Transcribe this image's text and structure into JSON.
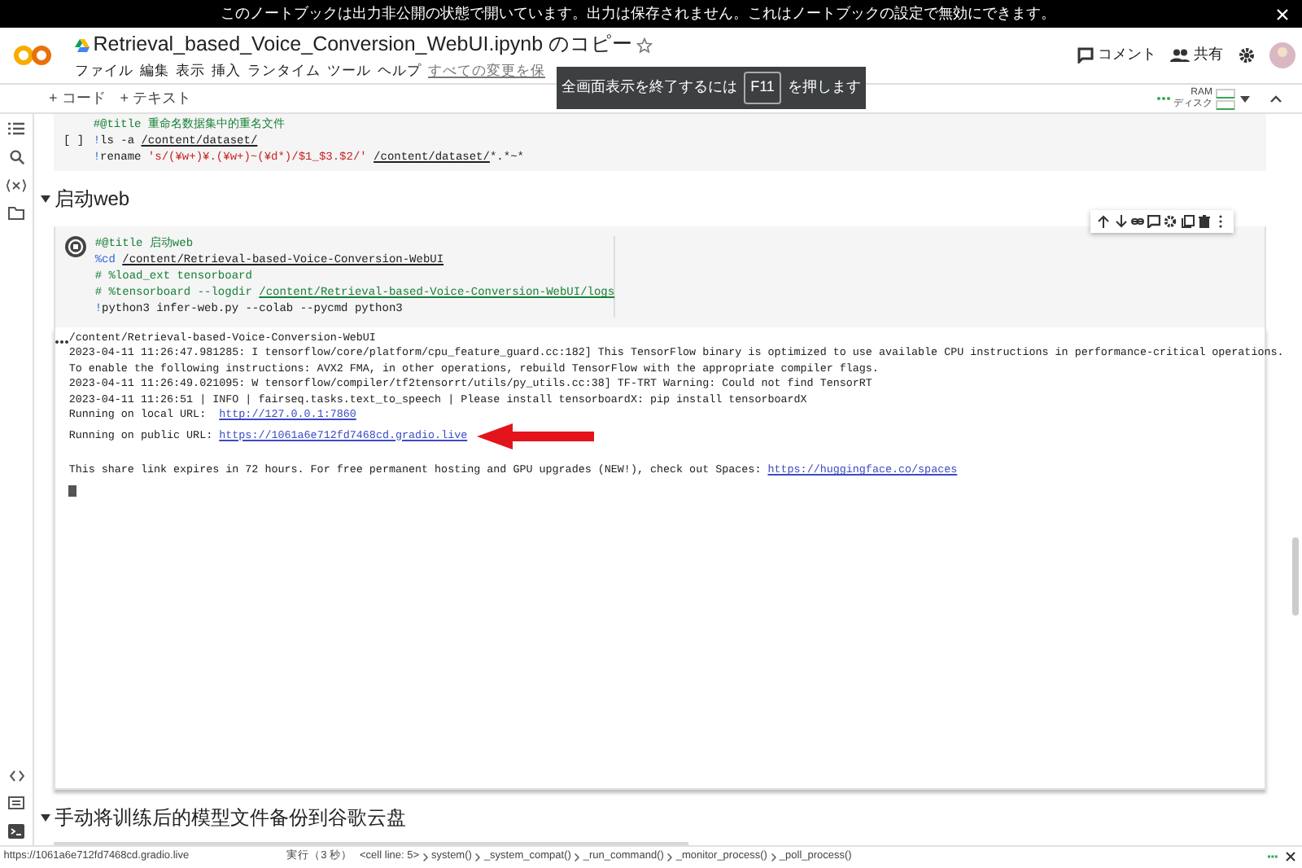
{
  "banner": {
    "text_before": "このノートブックは出力非公開の状態で開いています。出力は保存されません。これは",
    "link": "ノートブックの設定",
    "text_after": "で無効にできます。"
  },
  "header": {
    "title": "Retrieval_based_Voice_Conversion_WebUI.ipynb のコピー",
    "menu": [
      "ファイル",
      "編集",
      "表示",
      "挿入",
      "ランタイム",
      "ツール",
      "ヘルプ"
    ],
    "save_status": "すべての変更を保",
    "comment_button": "コメント",
    "share_button": "共有"
  },
  "toast": {
    "text_before": "全画面表示を終了するには",
    "key": "F11",
    "text_after": "を押します"
  },
  "toolbar": {
    "add_code": "+ コード",
    "add_text": "+ テキスト",
    "ram_label": "RAM",
    "disk_label": "ディスク"
  },
  "cells": [
    {
      "kind": "code",
      "partial": true,
      "run_label": "[ ]",
      "lines": [
        [
          {
            "kind": "comment",
            "text": "#@title 重命名数据集中的重名文件"
          }
        ],
        [
          {
            "kind": "magic",
            "text": "!"
          },
          {
            "kind": "plain",
            "text": "ls -a "
          },
          {
            "kind": "path",
            "text": "/content/dataset/"
          }
        ],
        [
          {
            "kind": "magic",
            "text": "!"
          },
          {
            "kind": "plain",
            "text": "rename "
          },
          {
            "kind": "string",
            "text": "'s/(¥w+)¥.(¥w+)~(¥d*)/$1_$3.$2/' "
          },
          {
            "kind": "path",
            "text": "/content/dataset/"
          },
          {
            "kind": "plain",
            "text": "*.*~*"
          }
        ]
      ]
    },
    {
      "kind": "section",
      "title": "启动web",
      "expanded": true
    },
    {
      "kind": "code",
      "partial": false,
      "running": true,
      "lines": [
        [
          {
            "kind": "comment",
            "text": "#@title 启动web"
          }
        ],
        [
          {
            "kind": "magic",
            "text": "%cd "
          },
          {
            "kind": "path",
            "text": "/content/Retrieval-based-Voice-Conversion-WebUI"
          }
        ],
        [
          {
            "kind": "comment",
            "text": "# %load_ext tensorboard"
          }
        ],
        [
          {
            "kind": "comment",
            "text": "# %tensorboard --logdir "
          },
          {
            "kind": "commentpath",
            "text": "/content/Retrieval-based-Voice-Conversion-WebUI/logs"
          }
        ],
        [
          {
            "kind": "magic",
            "text": "!"
          },
          {
            "kind": "plain",
            "text": "python3 infer-web.py --colab --pycmd python3"
          }
        ]
      ],
      "output": [
        [
          {
            "kind": "plain",
            "text": "/content/Retrieval-based-Voice-Conversion-WebUI"
          }
        ],
        [
          {
            "kind": "plain",
            "text": "2023-04-11 11:26:47.981285: I tensorflow/core/platform/cpu_feature_guard.cc:182] This TensorFlow binary is optimized to use available CPU instructions in performance-critical operations."
          }
        ],
        [
          {
            "kind": "plain",
            "text": "To enable the following instructions: AVX2 FMA, in other operations, rebuild TensorFlow with the appropriate compiler flags."
          }
        ],
        [
          {
            "kind": "plain",
            "text": "2023-04-11 11:26:49.021095: W tensorflow/compiler/tf2tensorrt/utils/py_utils.cc:38] TF-TRT Warning: Could not find TensorRT"
          }
        ],
        [
          {
            "kind": "plain",
            "text": "2023-04-11 11:26:51 | INFO | fairseq.tasks.text_to_speech | Please install tensorboardX: pip install tensorboardX"
          }
        ],
        [
          {
            "kind": "plain",
            "text": "Running on local URL:  "
          },
          {
            "kind": "link",
            "text": "http://127.0.0.1:7860"
          }
        ],
        [
          {
            "kind": "plain",
            "text": "Running on public URL: "
          },
          {
            "kind": "link",
            "text": "https://1061a6e712fd7468cd.gradio.live"
          }
        ],
        [
          {
            "kind": "gap"
          },
          {
            "kind": "plain",
            "text": "This share link expires in 72 hours. For free permanent hosting and GPU upgrades (NEW!), check out Spaces: "
          },
          {
            "kind": "link",
            "text": "https://huggingface.co/spaces"
          }
        ]
      ]
    },
    {
      "kind": "section",
      "title": "手动将训练后的模型文件备份到谷歌云盘",
      "expanded": true
    }
  ],
  "status_bar": {
    "link_preview": "https://1061a6e712fd7468cd.gradio.live",
    "run_time": "実行（3 秒）",
    "trace": [
      "<cell line: 5>",
      "system()",
      "_system_compat()",
      "_run_command()",
      "_monitor_process()",
      "_poll_process()"
    ]
  }
}
